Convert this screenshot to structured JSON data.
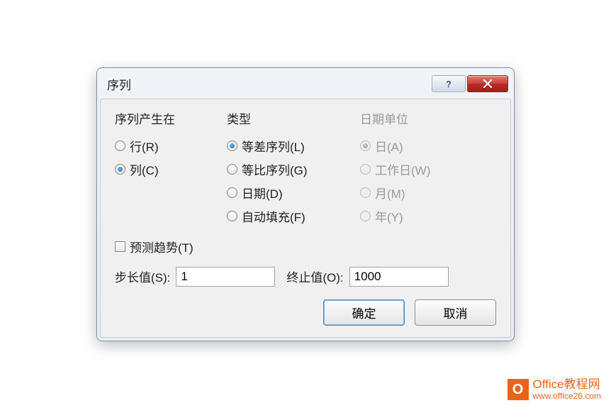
{
  "dialog": {
    "title": "序列",
    "columns": {
      "series_in": {
        "header": "序列产生在",
        "options": [
          {
            "label": "行(R)",
            "selected": false
          },
          {
            "label": "列(C)",
            "selected": true
          }
        ]
      },
      "type": {
        "header": "类型",
        "options": [
          {
            "label": "等差序列(L)",
            "selected": true
          },
          {
            "label": "等比序列(G)",
            "selected": false
          },
          {
            "label": "日期(D)",
            "selected": false
          },
          {
            "label": "自动填充(F)",
            "selected": false
          }
        ]
      },
      "date_unit": {
        "header": "日期单位",
        "disabled": true,
        "options": [
          {
            "label": "日(A)",
            "selected": true
          },
          {
            "label": "工作日(W)",
            "selected": false
          },
          {
            "label": "月(M)",
            "selected": false
          },
          {
            "label": "年(Y)",
            "selected": false
          }
        ]
      }
    },
    "trend_checkbox": {
      "label": "预测趋势(T)",
      "checked": false
    },
    "step": {
      "label": "步长值(S):",
      "value": "1"
    },
    "stop": {
      "label": "终止值(O):",
      "value": "1000"
    },
    "buttons": {
      "ok": "确定",
      "cancel": "取消"
    }
  },
  "watermark": {
    "icon_text": "O",
    "title": "Office教程网",
    "url": "www.office26.com"
  }
}
